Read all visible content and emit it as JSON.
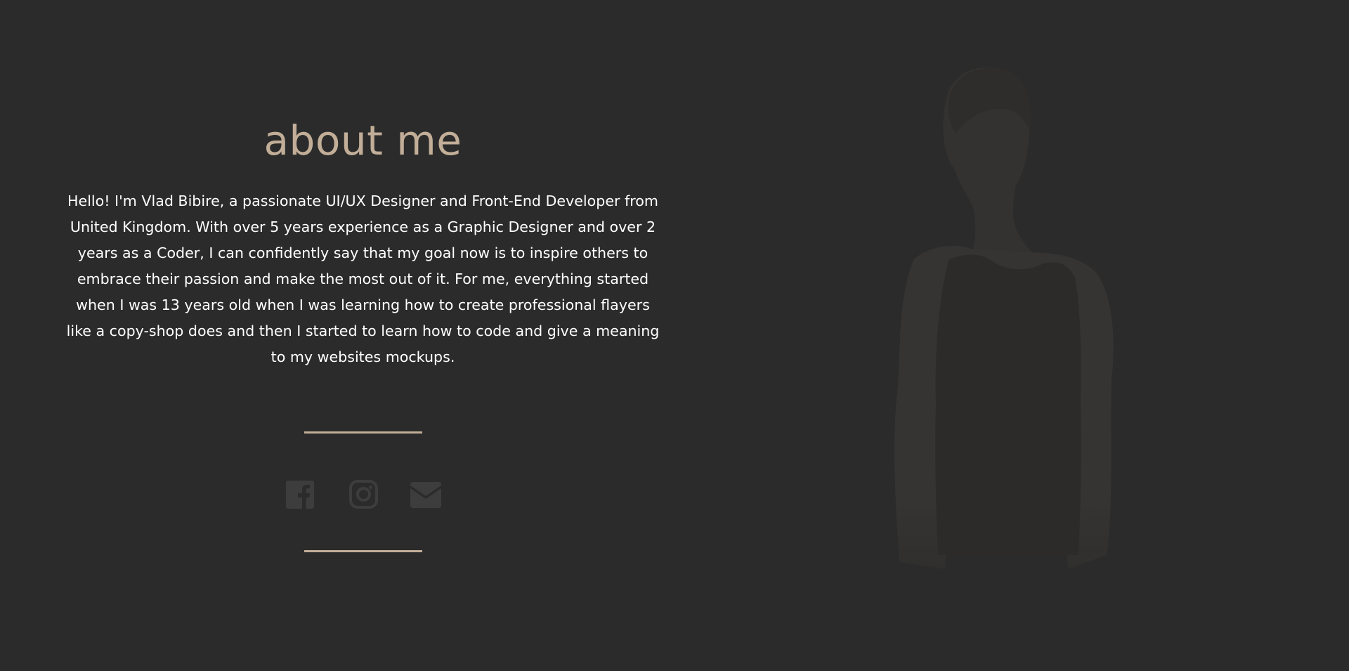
{
  "about": {
    "title": "about me",
    "body": "Hello! I'm Vlad Bibire, a passionate UI/UX Designer and Front-End Developer from United Kingdom. With over 5 years experience as a Graphic Designer and over 2 years as a Coder, I can confidently say that my goal now is to inspire others to embrace their passion and make the most out of it. For me, everything started when I was 13 years old when I was learning how to create professional flayers like a copy-shop does and then I started to learn how to code and give a meaning to my websites mockups."
  },
  "social": {
    "links": [
      {
        "icon": "facebook-icon"
      },
      {
        "icon": "instagram-icon"
      },
      {
        "icon": "mail-icon"
      }
    ],
    "icon_color": "#3d3d3d"
  },
  "colors": {
    "background": "#2b2b2b",
    "accent": "#c2ae98",
    "text": "#ffffff"
  }
}
